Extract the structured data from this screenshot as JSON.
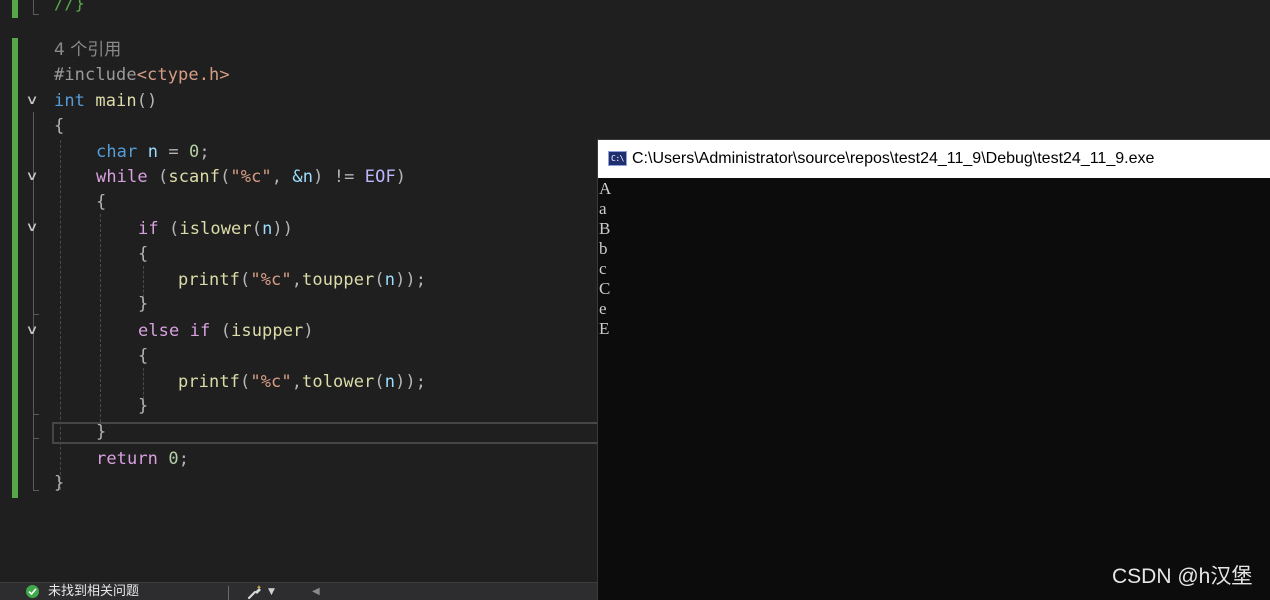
{
  "editor": {
    "codelens": "4 个引用",
    "lines": {
      "top_comment": "//}",
      "include_directive": "#include",
      "include_header": "<ctype.h>",
      "kw_int": "int",
      "fn_main": "main",
      "parens": "()",
      "brace_open": "{",
      "brace_close": "}",
      "kw_char": "char",
      "var_n": "n",
      "assign": " = ",
      "zero": "0",
      "semi": ";",
      "kw_while": "while",
      "fn_scanf": "scanf",
      "str_fmt": "\"%c\"",
      "amp_n": "&n",
      "neq": " != ",
      "macro_eof": "EOF",
      "kw_if": "if",
      "fn_islower": "islower",
      "fn_printf": "printf",
      "fn_toupper": "toupper",
      "kw_else": "else",
      "fn_isupper": "isupper",
      "fn_tolower": "tolower",
      "kw_return": "return"
    }
  },
  "statusbar": {
    "issues_text": "未找到相关问题",
    "brush_icon": "code-cleanup-icon"
  },
  "console": {
    "title": "C:\\Users\\Administrator\\source\\repos\\test24_11_9\\Debug\\test24_11_9.exe",
    "icon_label": "C:\\",
    "output": [
      "A",
      "a",
      "B",
      "b",
      "c",
      "C",
      "e",
      "E"
    ]
  },
  "watermark": "CSDN @h汉堡",
  "colors": {
    "keyword": "#569cd6",
    "control": "#d8a0df",
    "function": "#dcdcaa",
    "variable": "#9cdcfe",
    "string": "#d69d85",
    "number": "#b5cea8",
    "change_bar": "#57a64a",
    "console_bg": "#0c0c0c"
  }
}
